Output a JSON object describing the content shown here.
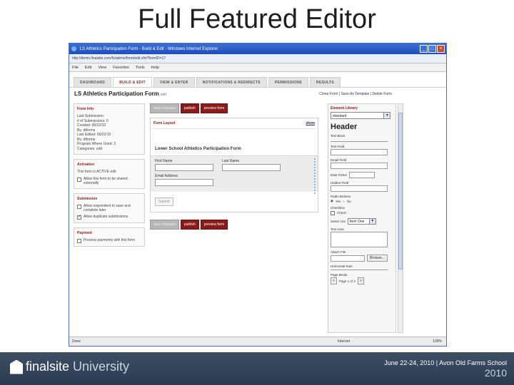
{
  "slide_title": "Full Featured Editor",
  "browser": {
    "window_title": "LS Athletics Participation Form - Build & Edit - Windows Internet Explorer",
    "address": "http://demo.finalsite.com/fs/admin/form/edit.cfm?formID=17",
    "menu": [
      "File",
      "Edit",
      "View",
      "Favorites",
      "Tools",
      "Help"
    ],
    "status_left": "Done",
    "status_zone": "Internet",
    "status_zoom": "100%"
  },
  "tabs": [
    "DASHBOARD",
    "BUILD & EDIT",
    "VIEW & ENTER",
    "NOTIFICATIONS & REDIRECTS",
    "PERMISSIONS",
    "RESULTS"
  ],
  "page": {
    "title": "LS Athletics Participation Form",
    "edit_link": "edit",
    "links": "Clone Form | Save As Template | Delete Form"
  },
  "form_info": {
    "heading": "Form Info",
    "lines": [
      "Last Submission:",
      "# of Submissions: 0",
      "Created: 06/22/10",
      "By: dtforms",
      "Last Edited: 06/22/10",
      "By: dtforms",
      "Program Where Used: 3",
      "Categories: edit"
    ]
  },
  "activation": {
    "heading": "Activation",
    "status": "This form is ACTIVE edit",
    "checkbox": "Allow this form to be shared externally"
  },
  "submission": {
    "heading": "Submission",
    "option1": "Allow respondent to save and complete later",
    "option2": "Allow duplicate submissions"
  },
  "payment": {
    "heading": "Payment",
    "option": "Process payments with this form"
  },
  "toolbar": {
    "save": "save changes",
    "publish": "publish",
    "preview": "preview form"
  },
  "layout": {
    "heading": "Form Layout",
    "show": "show",
    "form_title": "Lower School Athletics Participation Form",
    "first_name": "First Name",
    "last_name": "Last Name",
    "email": "Email Address",
    "submit": "Submit"
  },
  "library": {
    "heading": "Element Library",
    "select": "standard",
    "header": "Header",
    "text_block": "Text Block",
    "text_field": "Text Field",
    "email_field": "Email Field",
    "date_picker": "Date Picker",
    "hidden_field": "Hidden Field",
    "radio": "Radio Buttons",
    "radio_yes": "Yes",
    "radio_no": "No",
    "checkbox": "Checkbox",
    "checkbox_opt": "Check",
    "select_list": "Select List",
    "select_list_value": "Item One",
    "text_area": "Text Area",
    "attach_file": "Attach File",
    "browse": "Browse...",
    "horizontal_rule": "Horizontal Rule",
    "page_break": "Page Break",
    "page_label": "Page 1 of 2"
  },
  "footer": {
    "brand": "finalsite",
    "brand_suffix": "University",
    "date": "June 22-24, 2010 | Avon Old Farms School",
    "year": "2010"
  }
}
